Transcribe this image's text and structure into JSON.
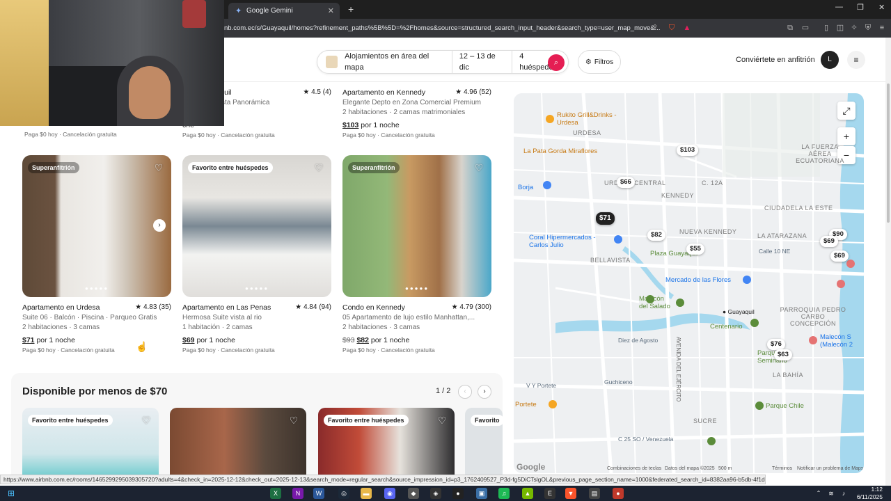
{
  "browser": {
    "tab_title": "Google Gemini",
    "url": "nb.com.ec/s/Guayaquil/homes?refinement_paths%5B%5D=%2Fhomes&source=structured_search_input_header&search_type=user_map_move&..."
  },
  "header": {
    "search_location": "Alojamientos en área del mapa",
    "search_dates": "12 – 13 de dic",
    "search_guests": "4 huéspedes",
    "filters_label": "Filtros",
    "host_link": "Conviértete en anfitrión",
    "avatar_letter": "L"
  },
  "top_row": [
    {
      "title": "o en Guayaquil",
      "rating": "★ 4.5 (4)",
      "line1": "ellini I con Vista Panorámica",
      "line2": "es · 2 camas",
      "price": "che",
      "pay": "Paga $0 hoy · Cancelación gratuita"
    },
    {
      "title": "Apartamento en Kennedy",
      "rating": "★ 4.96 (52)",
      "line1": "Elegante Depto en Zona Comercial Premium",
      "line2": "2 habitaciones · 2 camas matrimoniales",
      "price_amount": "$103",
      "price_suffix": " por 1 noche",
      "pay": "Paga $0 hoy · Cancelación gratuita"
    }
  ],
  "first_pay": "Paga $0 hoy · Cancelación gratuita",
  "listings": [
    {
      "badge": "Superanfitrión",
      "title": "Apartamento en Urdesa",
      "rating": "★ 4.83 (35)",
      "line1": "Suite 06 · Balcón · Piscina · Parqueo Gratis",
      "line2": "2 habitaciones · 3 camas",
      "price_old": "",
      "price_amount": "$71",
      "price_suffix": " por 1 noche",
      "pay": "Paga $0 hoy · Cancelación gratuita"
    },
    {
      "badge": "Favorito entre huéspedes",
      "title": "Apartamento en Las Penas",
      "rating": "★ 4.84 (94)",
      "line1": "Hermosa Suite vista al rio",
      "line2": "1 habitación · 2 camas",
      "price_old": "",
      "price_amount": "$69",
      "price_suffix": " por 1 noche",
      "pay": "Paga $0 hoy · Cancelación gratuita"
    },
    {
      "badge": "Superanfitrión",
      "title": "Condo en Kennedy",
      "rating": "★ 4.79 (300)",
      "line1": "05 Apartamento de lujo estilo Manhattan,...",
      "line2": "2 habitaciones · 3 camas",
      "price_old": "$93",
      "price_amount": "$82",
      "price_suffix": " por 1 noche",
      "pay": "Paga $0 hoy · Cancelación gratuita"
    }
  ],
  "section": {
    "heading": "Disponible por menos de $70",
    "pager": "1 / 2",
    "cards": [
      {
        "badge": "Favorito entre huéspedes"
      },
      {
        "badge": ""
      },
      {
        "badge": "Favorito entre huéspedes"
      },
      {
        "badge": "Favorito"
      }
    ]
  },
  "map": {
    "pins": [
      "$103",
      "$66",
      "$71",
      "$82",
      "$55",
      "$90",
      "$69",
      "$69",
      "$76",
      "$63"
    ],
    "labels": {
      "urdesa": "URDESA",
      "kennedy": "KENNEDY",
      "la_fuerza": "LA FUERZA AÉREA ECUATORIANA",
      "ciudadela": "CIUDADELA LA ESTE",
      "c12a": "C. 12A",
      "urdesa_central": "URDESA CENTRAL",
      "bellavista": "BELLAVISTA",
      "nueva_kennedy": "NUEVA KENNEDY",
      "atarazana": "LA ATARAZANA",
      "parroquia": "PARROQUIA PEDRO CARBO CONCEPCIÓN",
      "la_bahia": "LA BAHÍA",
      "sucre": "SUCRE",
      "rukito": "Rukito Grill&Drinks - Urdesa",
      "la_pata": "La Pata Gorda Miraflores",
      "borja": "Borja",
      "coral": "Coral Hipermercados - Carlos Julio",
      "plaza": "Plaza Guayaquil",
      "mercado": "Mercado de las Flores",
      "malecon_salado": "Malecón del Salado",
      "guayaquil": "Guayaquil",
      "centenario": "Centenario",
      "parque_seminario": "Parque Seminario",
      "parque_chile": "Parque Chile",
      "malecon2000": "Malecón S (Malecón 2",
      "portete": "Portete",
      "diez_agosto": "Diez de Agosto",
      "guchiceno": "Guchiceno",
      "vy_portete": "V Y Portete",
      "c_venezuela": "C 25 SO / Venezuela",
      "avenida": "AVENIDA DEL EJÉRCITO",
      "calle10": "Calle 10 NE"
    },
    "footer": {
      "shortcuts": "Combinaciones de teclas",
      "data": "Datos del mapa ©2025",
      "scale": "500 m",
      "terms": "Términos",
      "report": "Notificar un problema de Maps"
    },
    "google": "Google"
  },
  "status_url": "https://www.airbnb.com.ec/rooms/1465299295039305720?adults=4&check_in=2025-12-12&check_out=2025-12-13&search_mode=regular_search&source_impression_id=p3_1762409527_P3d-fg5DiCTslgOL&previous_page_section_name=1000&federated_search_id=8382aa96-b5db-4f1d-951b-a6d46ca32e68",
  "taskbar": {
    "time": "1:12",
    "date": "6/11/2025"
  }
}
